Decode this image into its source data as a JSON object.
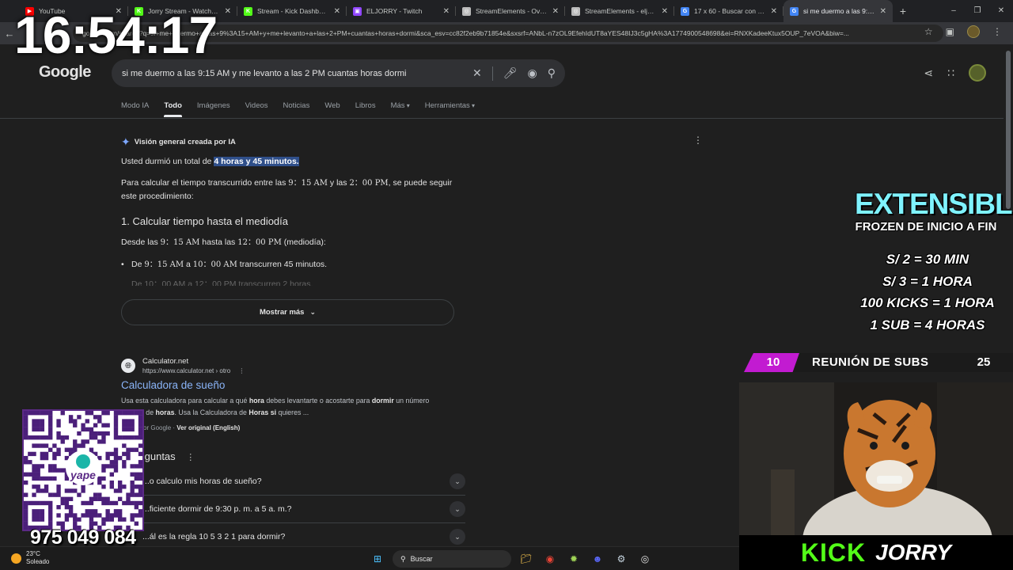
{
  "browser": {
    "tabs": [
      {
        "title": "YouTube",
        "favicon_color": "#ff0000",
        "glyph": "▶"
      },
      {
        "title": "Jorry Stream - Watch Live",
        "favicon_color": "#53fc18",
        "glyph": "K"
      },
      {
        "title": "Stream - Kick Dashboard",
        "favicon_color": "#53fc18",
        "glyph": "K"
      },
      {
        "title": "ELJORRY - Twitch",
        "favicon_color": "#9146ff",
        "glyph": "▣"
      },
      {
        "title": "StreamElements - Overlay",
        "favicon_color": "#bbbbbb",
        "glyph": "◎"
      },
      {
        "title": "StreamElements - eljorry",
        "favicon_color": "#bbbbbb",
        "glyph": "◎"
      },
      {
        "title": "17 x 60 - Buscar con Google",
        "favicon_color": "#4285f4",
        "glyph": "G"
      },
      {
        "title": "si me duermo a las 9:15 A",
        "favicon_color": "#4285f4",
        "glyph": "G"
      }
    ],
    "active_tab_index": 7,
    "url": "google.com/search?q=si+me+duermo+a+las+9%3A15+AM+y+me+levanto+a+las+2+PM+cuantas+horas+dormi&sca_esv=cc82f2eb9b71854e&sxsrf=ANbL-n7zOL9EfehIdUT8aYES48IJ3c5gHA%3A1774900548698&ei=RNXKadeeKtux5OUP_7eVOA&biw=..."
  },
  "search": {
    "logo": "Google",
    "query": "si me duermo a las 9:15 AM y me levanto a las 2 PM cuantas horas dormi",
    "tabs": [
      "Modo IA",
      "Todo",
      "Imágenes",
      "Videos",
      "Noticias",
      "Web",
      "Libros",
      "Más",
      "Herramientas"
    ],
    "active_tab": "Todo"
  },
  "ai_overview": {
    "header": "Visión general creada por IA",
    "answer_prefix": "Usted durmió un total de ",
    "answer_highlight": "4 horas y 45 minutos.",
    "intro_a": "Para calcular el tiempo transcurrido entre las ",
    "intro_t1": "9：15 AM",
    "intro_b": " y las ",
    "intro_t2": "2：00 PM",
    "intro_c": ", se puede seguir este procedimiento:",
    "step_heading": "1. Calcular tiempo hasta el mediodía",
    "step_a": "Desde las ",
    "step_t1": "9：15 AM",
    "step_b": " hasta las ",
    "step_t2": "12：00 PM",
    "step_c": " (mediodía):",
    "bullet1_a": "De ",
    "bullet1_t1": "9：15 AM",
    "bullet1_b": " a ",
    "bullet1_t2": "10：00 AM",
    "bullet1_c": " transcurren 45 minutos.",
    "bullet2": "De 10：00 AM a 12：00 PM transcurren 2 horas.",
    "show_more": "Mostrar más"
  },
  "result": {
    "site": "Calculator.net",
    "url": "https://www.calculator.net › otro",
    "title": "Calculadora de sueño",
    "snippet_1": "Usa esta calculadora para calcular a qué ",
    "snippet_b1": "hora",
    "snippet_2": " debes levantarte o acostarte para ",
    "snippet_b2": "dormir",
    "snippet_3": " un número",
    "snippet_4": "...inado de ",
    "snippet_b3": "horas",
    "snippet_5": ". Usa la Calculadora de ",
    "snippet_b4": "Horas si",
    "snippet_6": " quieres ...",
    "translated": "...cido por Google · ",
    "translated_link": "Ver original (English)"
  },
  "paa": {
    "heading": "...preguntas",
    "items": [
      "...o calculo mis horas de sueño?",
      "...ficiente dormir de 9:30 p. m. a 5 a. m.?",
      "...ál es la regla 10 5 3 2 1 para dormir?"
    ]
  },
  "taskbar": {
    "temp": "23°C",
    "condition": "Soleado",
    "search_label": "Buscar"
  },
  "overlay": {
    "clock": "16:54:17",
    "promo_title": "EXTENSIBLE",
    "promo_subtitle": "FROZEN DE INICIO A FIN",
    "rates": [
      "S/ 2 = 30 MIN",
      "S/ 3  = 1 HORA",
      "100 KICKS = 1 HORA",
      "1 SUB = 4 HORAS"
    ],
    "sub_goal": {
      "current": "10",
      "label": "REUNIÓN DE SUBS",
      "goal": "25"
    },
    "kick_logo": "KICK",
    "kick_name": "JORRY",
    "qr_brand": "yape",
    "qr_number": "975 049 084",
    "accent": "#c21bd1",
    "kick_green": "#53fc18"
  }
}
